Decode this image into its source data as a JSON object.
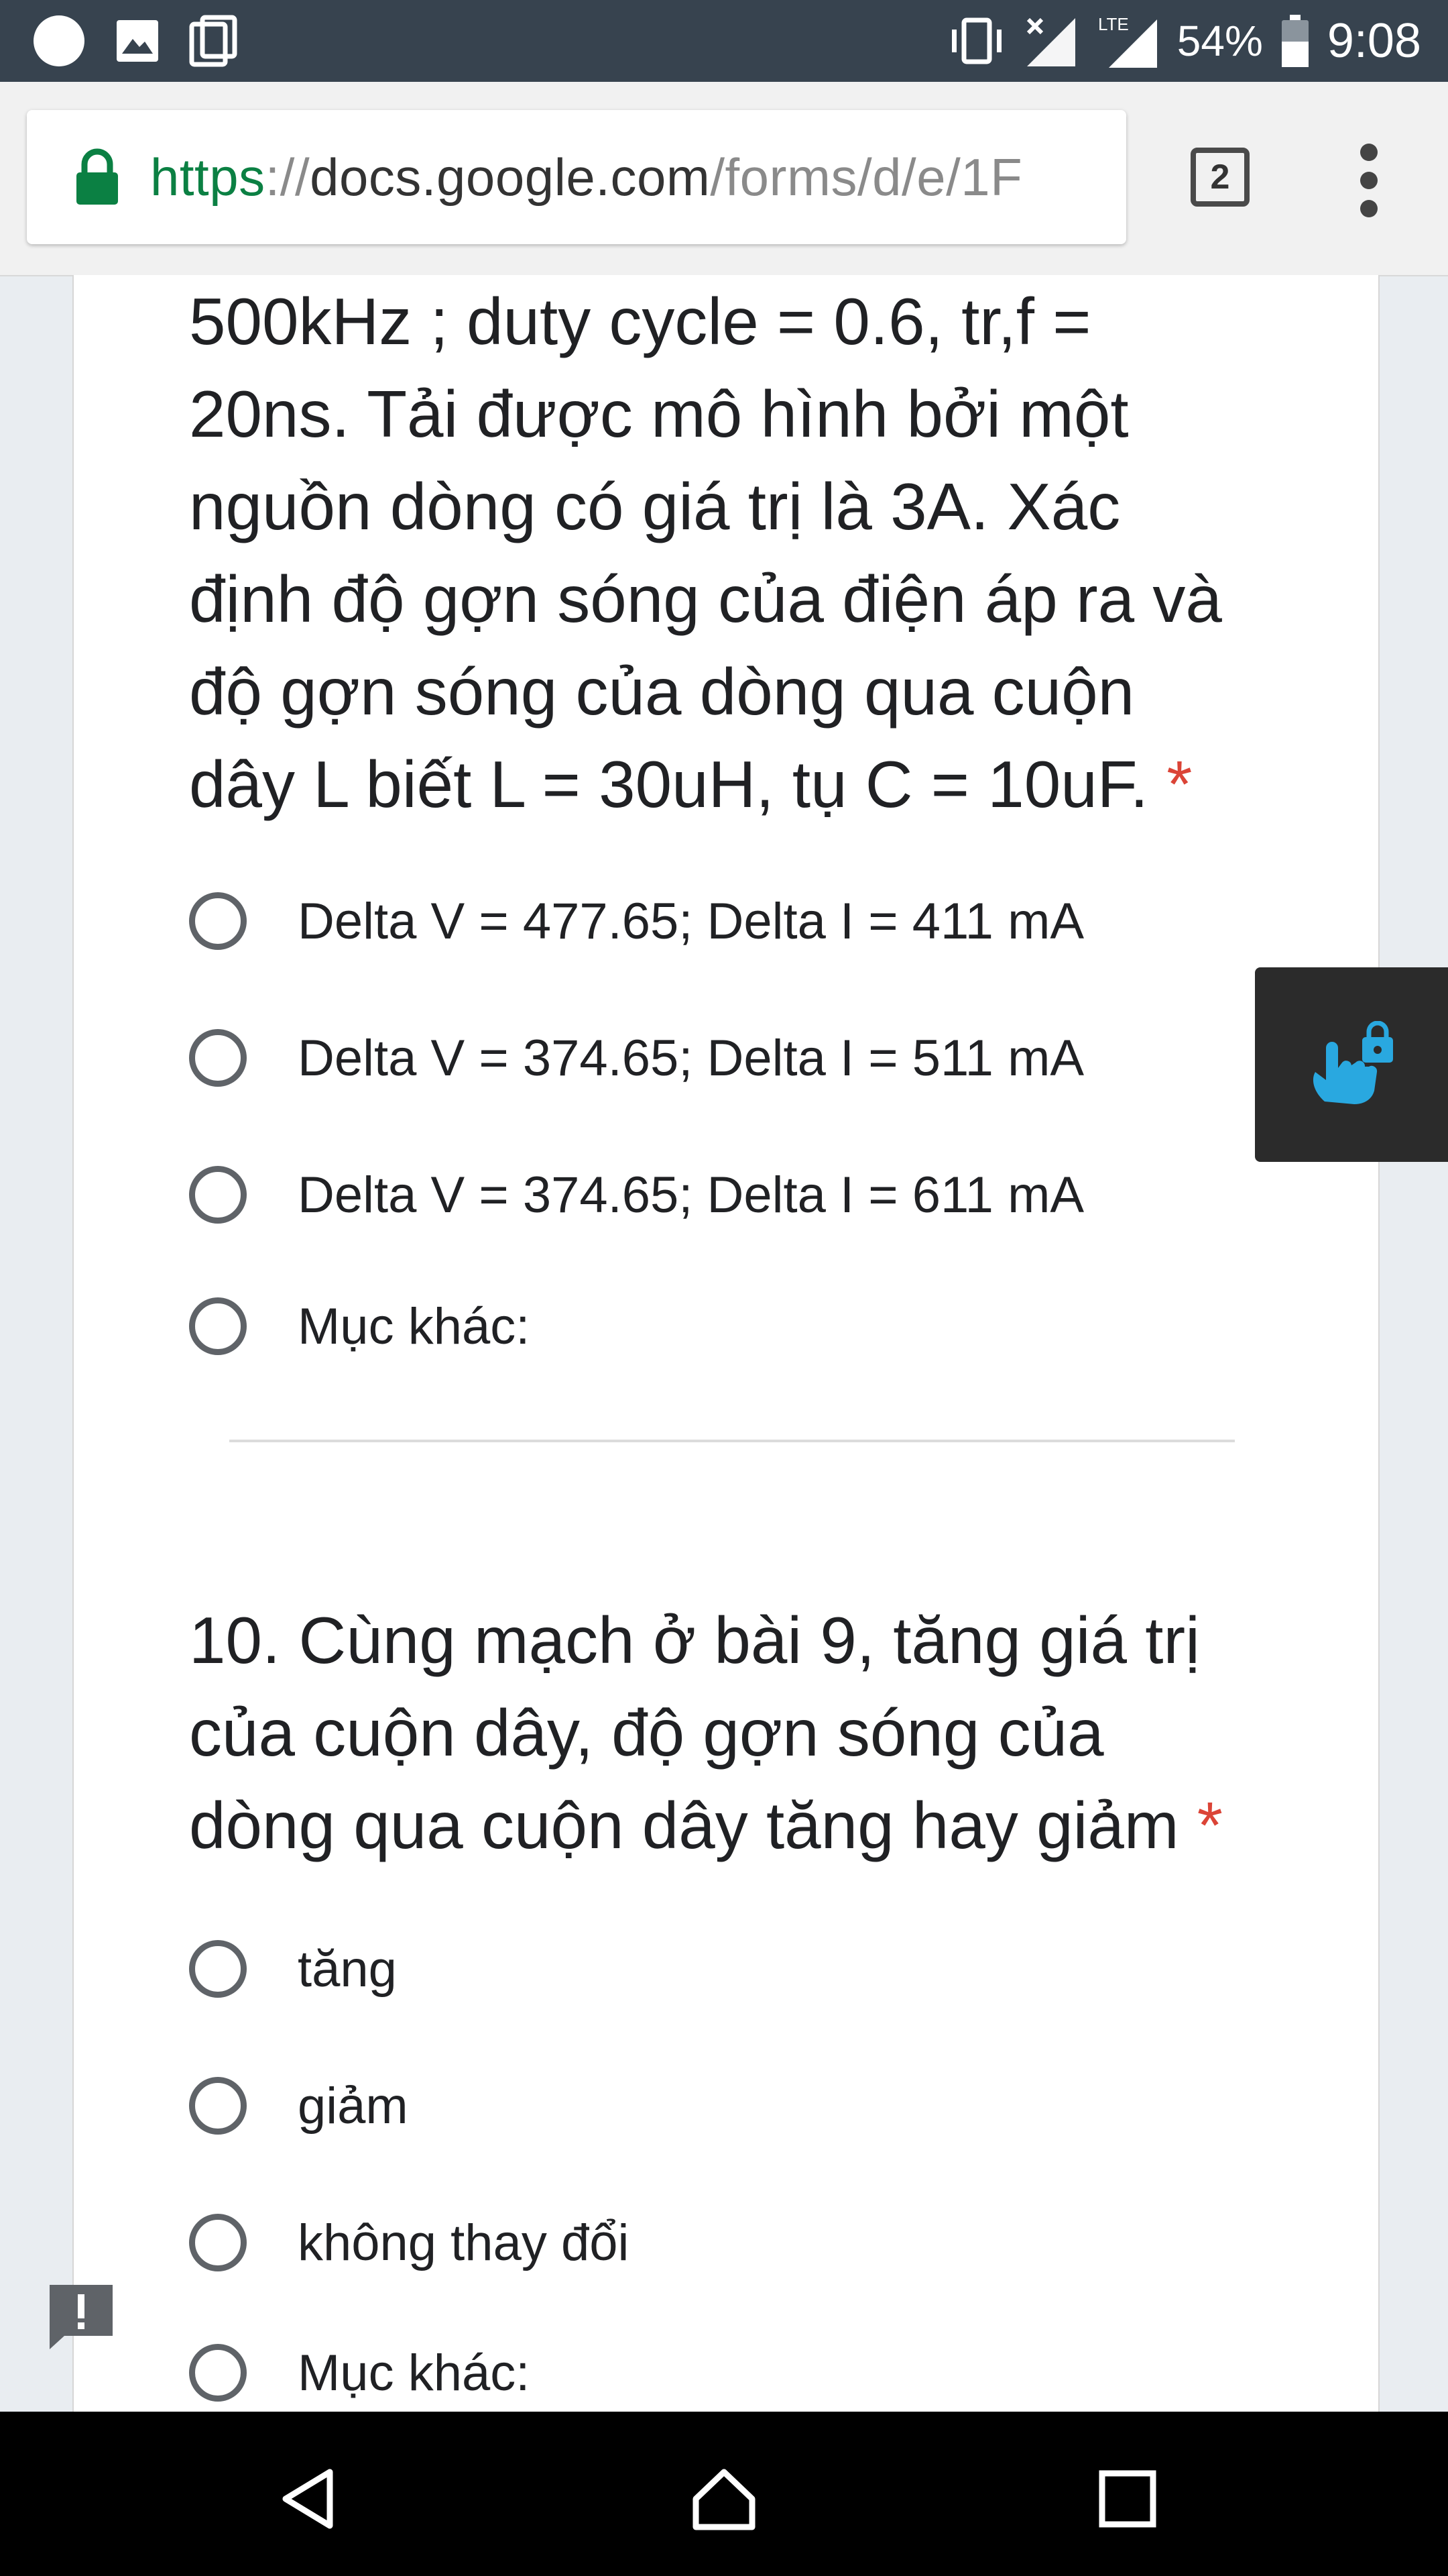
{
  "status_bar": {
    "battery": "54%",
    "time": "9:08",
    "network": "LTE",
    "icons": [
      "circle-notification-icon",
      "image-notification-icon",
      "screenshot-notification-icon",
      "vibrate-icon",
      "signal-icon",
      "lte-signal-icon",
      "battery-icon"
    ]
  },
  "browser": {
    "url_scheme": "https",
    "url_sep": "://",
    "url_host": "docs.google.com",
    "url_path": "/forms/d/e/1F",
    "tab_count": "2",
    "colors": {
      "scheme": "#0b8043",
      "host": "#333333",
      "path": "#8a8a8a"
    }
  },
  "question9": {
    "lines": [
      "500kHz ; duty cycle = 0.6, tr,f =",
      "20ns. Tải được mô hình bởi một",
      "nguồn dòng có giá trị là 3A. Xác",
      "định độ gợn sóng của điện áp ra và",
      "độ gợn sóng của dòng qua cuộn",
      "dây L biết L = 30uH, tụ C = 10uF."
    ],
    "required": "*",
    "options": [
      "Delta V = 477.65; Delta I = 411 mA",
      "Delta V = 374.65; Delta I = 511 mA",
      "Delta V = 374.65; Delta I = 611 mA",
      "Mục khác:"
    ]
  },
  "question10": {
    "lines": [
      "10. Cùng mạch ở bài 9, tăng giá trị",
      "của cuộn dây, độ gợn sóng của",
      "dòng qua cuộn dây tăng hay giảm"
    ],
    "required": "*",
    "options": [
      "tăng",
      "giảm",
      "không thay đổi",
      "Mục khác:"
    ]
  },
  "accent": {
    "required": "#db4437",
    "radio": "#5f6368",
    "widget_icon": "#29a8e0"
  }
}
